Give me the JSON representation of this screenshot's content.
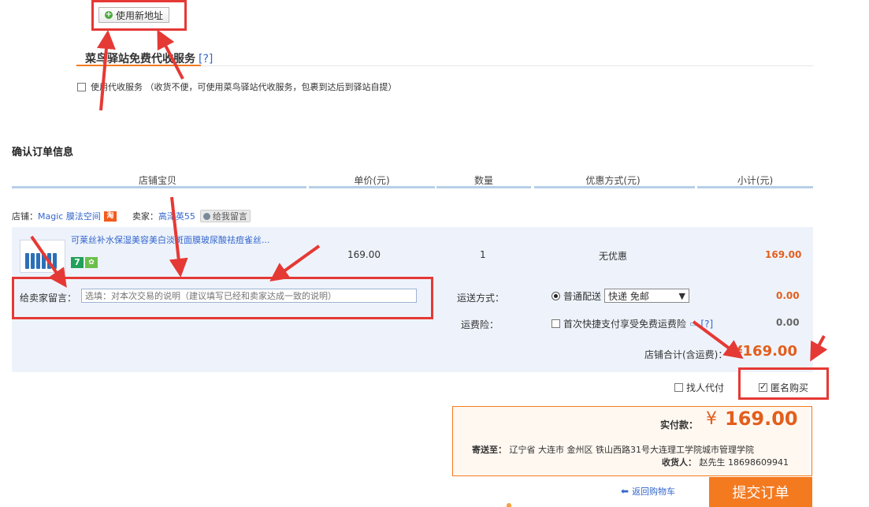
{
  "address": {
    "new_address_button": "使用新地址"
  },
  "cainiao": {
    "title": "菜鸟驿站免费代收服务",
    "help": "[?]",
    "option_label": "使用代收服务 （收货不便，可使用菜鸟驿站代收服务，包裹到达后到驿站自提）"
  },
  "order": {
    "section_title": "确认订单信息",
    "columns": [
      "店铺宝贝",
      "单价(元)",
      "数量",
      "优惠方式(元)",
      "小计(元)"
    ],
    "shop_label": "店铺：",
    "shop_name": "Magic 膜法空间",
    "shop_badge": "淘",
    "seller_label": "卖家：",
    "seller_name": "高泽英55",
    "message_me": "给我留言",
    "item": {
      "title": "可莱丝补水保湿美容美白淡斑面膜玻尿酸祛痘雀丝...",
      "badge_7": "7",
      "price": "169.00",
      "quantity": "1",
      "discount": "无优惠",
      "subtotal": "169.00"
    },
    "message_label": "给卖家留言：",
    "message_placeholder": "选填：对本次交易的说明（建议填写已经和卖家达成一致的说明）",
    "shipping_label": "运送方式：",
    "shipping_option": "普通配送",
    "shipping_select": "快递 免邮",
    "shipping_fee": "0.00",
    "insurance_label": "运费险：",
    "insurance_option": "首次快捷支付享受免费运费险",
    "insurance_help": "[?]",
    "insurance_fee": "0.00",
    "shop_total_label": "店铺合计(含运费)：",
    "shop_total": "¥169.00",
    "proxy_pay": "找人代付",
    "anonymous_buy": "匿名购买",
    "anonymous_checked": true
  },
  "payment": {
    "paid_label": "实付款：",
    "currency": "¥",
    "amount": "169.00",
    "ship_to_label": "寄送至：",
    "ship_to_address": "辽宁省 大连市 金州区 铁山西路31号大连理工学院城市管理学院",
    "receiver_label": "收货人：",
    "receiver": "赵先生 18698609941",
    "back_to_cart": "返回购物车",
    "submit": "提交订单"
  },
  "colors": {
    "accent": "#f47a20",
    "price": "#e35e1d",
    "link": "#3366cc",
    "annotation": "#e53935",
    "row_bg": "#eef3fb"
  }
}
